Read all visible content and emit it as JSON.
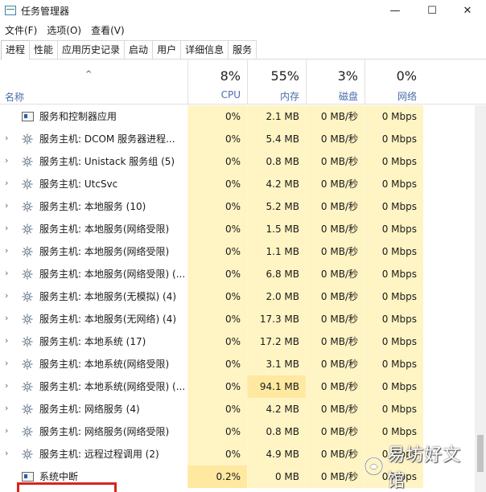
{
  "window": {
    "title": "任务管理器",
    "controls": {
      "minimize": "—",
      "maximize": "☐",
      "close": "✕"
    }
  },
  "menu": [
    "文件(F)",
    "选项(O)",
    "查看(V)"
  ],
  "tabs": [
    "进程",
    "性能",
    "应用历史记录",
    "启动",
    "用户",
    "详细信息",
    "服务"
  ],
  "active_tab": "进程",
  "columns": {
    "name": "名称",
    "sort_indicator": "^",
    "cpu": {
      "pct": "8%",
      "label": "CPU"
    },
    "memory": {
      "pct": "55%",
      "label": "内存"
    },
    "disk": {
      "pct": "3%",
      "label": "磁盘"
    },
    "network": {
      "pct": "0%",
      "label": "网络"
    }
  },
  "processes": [
    {
      "name": "服务和控制器应用",
      "icon": "window-app-icon",
      "expandable": false,
      "cpu": "0%",
      "mem": "2.1 MB",
      "disk": "0 MB/秒",
      "net": "0 Mbps"
    },
    {
      "name": "服务主机: DCOM 服务器进程...",
      "icon": "gear-icon",
      "expandable": true,
      "cpu": "0%",
      "mem": "5.4 MB",
      "disk": "0 MB/秒",
      "net": "0 Mbps"
    },
    {
      "name": "服务主机: Unistack 服务组 (5)",
      "icon": "gear-icon",
      "expandable": true,
      "cpu": "0%",
      "mem": "0.8 MB",
      "disk": "0 MB/秒",
      "net": "0 Mbps"
    },
    {
      "name": "服务主机: UtcSvc",
      "icon": "gear-icon",
      "expandable": true,
      "cpu": "0%",
      "mem": "4.2 MB",
      "disk": "0 MB/秒",
      "net": "0 Mbps"
    },
    {
      "name": "服务主机: 本地服务 (10)",
      "icon": "gear-icon",
      "expandable": true,
      "cpu": "0%",
      "mem": "5.2 MB",
      "disk": "0 MB/秒",
      "net": "0 Mbps"
    },
    {
      "name": "服务主机: 本地服务(网络受限)",
      "icon": "gear-icon",
      "expandable": true,
      "cpu": "0%",
      "mem": "1.5 MB",
      "disk": "0 MB/秒",
      "net": "0 Mbps"
    },
    {
      "name": "服务主机: 本地服务(网络受限)",
      "icon": "gear-icon",
      "expandable": true,
      "cpu": "0%",
      "mem": "1.1 MB",
      "disk": "0 MB/秒",
      "net": "0 Mbps"
    },
    {
      "name": "服务主机: 本地服务(网络受限) (...",
      "icon": "gear-icon",
      "expandable": true,
      "cpu": "0%",
      "mem": "6.8 MB",
      "disk": "0 MB/秒",
      "net": "0 Mbps"
    },
    {
      "name": "服务主机: 本地服务(无模拟) (4)",
      "icon": "gear-icon",
      "expandable": true,
      "cpu": "0%",
      "mem": "2.0 MB",
      "disk": "0 MB/秒",
      "net": "0 Mbps"
    },
    {
      "name": "服务主机: 本地服务(无网络) (4)",
      "icon": "gear-icon",
      "expandable": true,
      "cpu": "0%",
      "mem": "17.3 MB",
      "disk": "0 MB/秒",
      "net": "0 Mbps"
    },
    {
      "name": "服务主机: 本地系统 (17)",
      "icon": "gear-icon",
      "expandable": true,
      "cpu": "0%",
      "mem": "17.2 MB",
      "disk": "0 MB/秒",
      "net": "0 Mbps"
    },
    {
      "name": "服务主机: 本地系统(网络受限)",
      "icon": "gear-icon",
      "expandable": true,
      "cpu": "0%",
      "mem": "3.1 MB",
      "disk": "0 MB/秒",
      "net": "0 Mbps"
    },
    {
      "name": "服务主机: 本地系统(网络受限) (...",
      "icon": "gear-icon",
      "expandable": true,
      "cpu": "0%",
      "mem": "94.1 MB",
      "disk": "0 MB/秒",
      "net": "0 Mbps"
    },
    {
      "name": "服务主机: 网络服务 (4)",
      "icon": "gear-icon",
      "expandable": true,
      "cpu": "0%",
      "mem": "4.2 MB",
      "disk": "0 MB/秒",
      "net": "0 Mbps"
    },
    {
      "name": "服务主机: 网络服务(网络受限)",
      "icon": "gear-icon",
      "expandable": true,
      "cpu": "0%",
      "mem": "0.8 MB",
      "disk": "0 MB/秒",
      "net": "0 Mbps"
    },
    {
      "name": "服务主机: 远程过程调用 (2)",
      "icon": "gear-icon",
      "expandable": true,
      "cpu": "0%",
      "mem": "4.9 MB",
      "disk": "0 MB/秒",
      "net": "0 Mbps"
    },
    {
      "name": "系统中断",
      "icon": "window-app-icon",
      "expandable": false,
      "cpu": "0.2%",
      "mem": "0 MB",
      "disk": "0 MB/秒",
      "net": "0 Mbps"
    }
  ],
  "watermark": {
    "text": "易坊好文馆"
  },
  "colors": {
    "heat_light": "#fff4c4",
    "heat_medium": "#ffe9a0",
    "header_label": "#4a6da8",
    "highlight_box": "#d9231c"
  }
}
